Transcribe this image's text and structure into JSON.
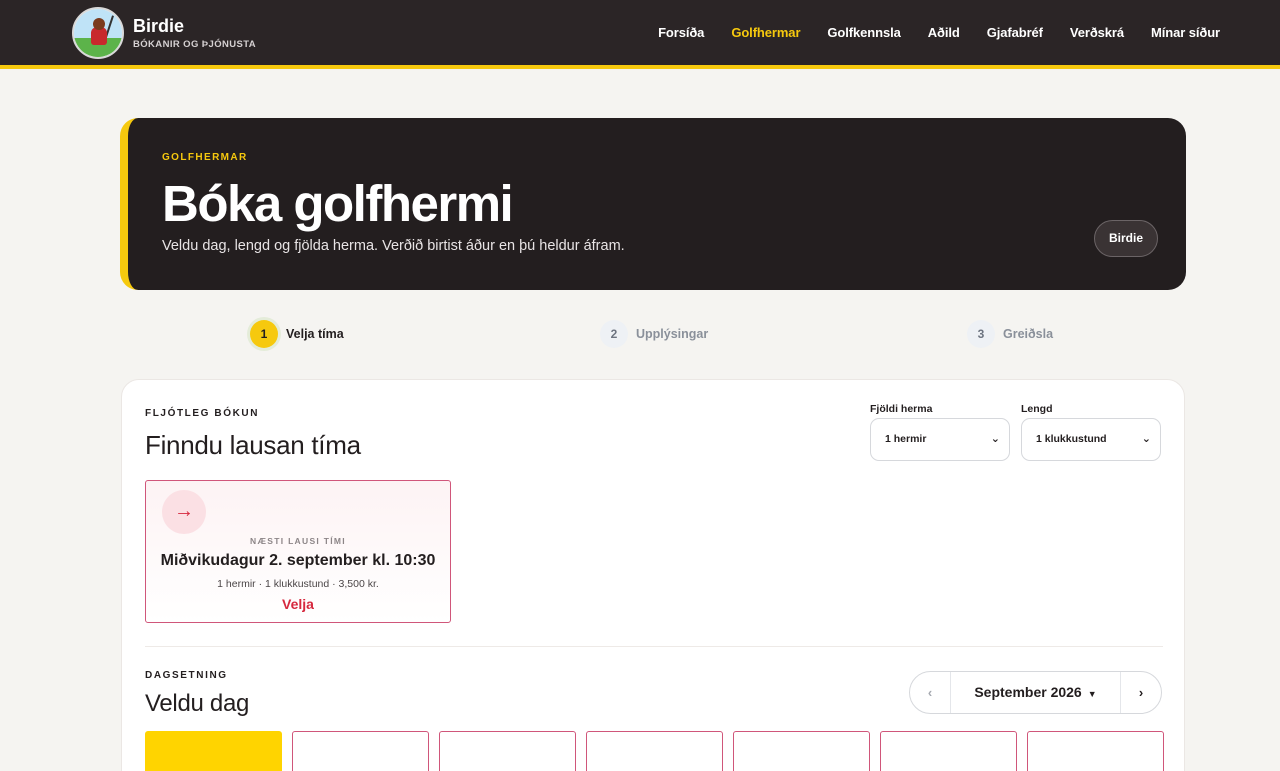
{
  "brand": {
    "name": "Birdie",
    "subtitle": "BÓKANIR OG ÞJÓNUSTA"
  },
  "nav": {
    "items": [
      {
        "label": "Forsíða",
        "active": false
      },
      {
        "label": "Golfhermar",
        "active": true
      },
      {
        "label": "Golfkennsla",
        "active": false
      },
      {
        "label": "Aðild",
        "active": false
      },
      {
        "label": "Gjafabréf",
        "active": false
      },
      {
        "label": "Verðskrá",
        "active": false
      },
      {
        "label": "Mínar síður",
        "active": false
      }
    ]
  },
  "hero": {
    "eyebrow": "GOLFHERMAR",
    "title": "Bóka golfhermi",
    "subtitle": "Veldu dag, lengd og fjölda herma. Verðið birtist áður en þú heldur áfram.",
    "badge": "Birdie"
  },
  "steps": [
    {
      "number": "1",
      "label": "Velja tíma",
      "active": true
    },
    {
      "number": "2",
      "label": "Upplýsingar",
      "active": false
    },
    {
      "number": "3",
      "label": "Greiðsla",
      "active": false
    }
  ],
  "quick_booking": {
    "eyebrow": "FLJÓTLEG BÓKUN",
    "title": "Finndu lausan tíma",
    "simulators_label": "Fjöldi herma",
    "simulators_value": "1 hermir",
    "duration_label": "Lengd",
    "duration_value": "1 klukkustund",
    "next_slot": {
      "arrow": "→",
      "label": "NÆSTI LAUSI TÍMI",
      "date": "Miðvikudagur 2. september kl. 10:30",
      "meta": "1 hermir · 1 klukkustund · 3,500 kr.",
      "cta": "Velja"
    }
  },
  "date_section": {
    "eyebrow": "DAGSETNING",
    "title": "Veldu dag",
    "month": "September 2026",
    "caret": "▼",
    "prev": "‹",
    "next": "›",
    "day_count": 7,
    "selected_index": 0
  },
  "colors": {
    "accent": "#f6c90e",
    "dark": "#231e1f",
    "danger": "#d6283e"
  }
}
